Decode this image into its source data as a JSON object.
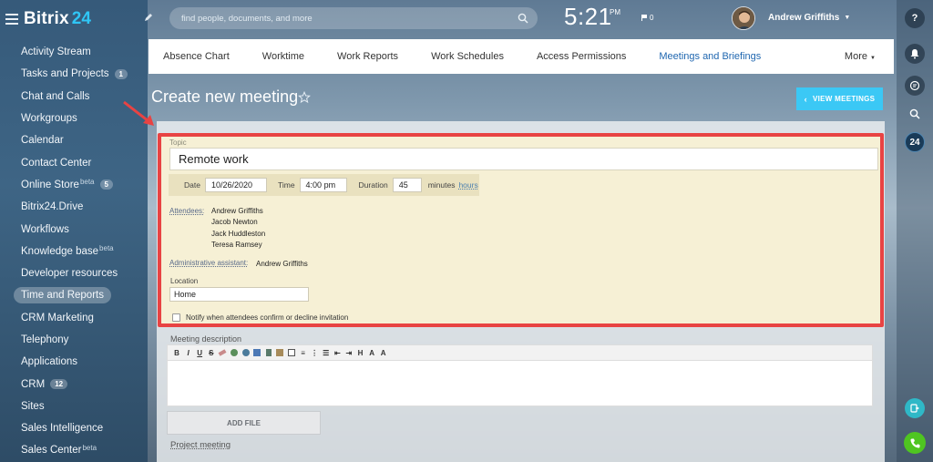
{
  "app": {
    "logo_text": "Bitrix",
    "logo_num": "24"
  },
  "sidebar": {
    "items": [
      {
        "label": "Activity Stream"
      },
      {
        "label": "Tasks and Projects",
        "count": "1"
      },
      {
        "label": "Chat and Calls"
      },
      {
        "label": "Workgroups"
      },
      {
        "label": "Calendar"
      },
      {
        "label": "Contact Center"
      },
      {
        "label": "Online Store",
        "sup": "beta",
        "count": "5"
      },
      {
        "label": "Bitrix24.Drive"
      },
      {
        "label": "Workflows"
      },
      {
        "label": "Knowledge base",
        "sup": "beta"
      },
      {
        "label": "Developer resources"
      },
      {
        "label": "Time and Reports",
        "active": true
      },
      {
        "label": "CRM Marketing"
      },
      {
        "label": "Telephony"
      },
      {
        "label": "Applications"
      },
      {
        "label": "CRM",
        "count": "12"
      },
      {
        "label": "Sites"
      },
      {
        "label": "Sales Intelligence"
      },
      {
        "label": "Sales Center",
        "sup": "beta"
      }
    ]
  },
  "header": {
    "search_placeholder": "find people, documents, and more",
    "time": "5:21",
    "ampm": "PM",
    "flag_count": "0",
    "user_name": "Andrew Griffiths"
  },
  "right_rail": {
    "counter": "24"
  },
  "tabs": [
    {
      "label": "Absence Chart"
    },
    {
      "label": "Worktime"
    },
    {
      "label": "Work Reports"
    },
    {
      "label": "Work Schedules"
    },
    {
      "label": "Access Permissions"
    },
    {
      "label": "Meetings and Briefings",
      "active": true
    }
  ],
  "tabs_more": "More",
  "page": {
    "title": "Create new meeting",
    "view_meetings_button": "VIEW MEETINGS"
  },
  "form": {
    "topic_label": "Topic",
    "topic_value": "Remote work",
    "date_label": "Date",
    "date_value": "10/26/2020",
    "time_label": "Time",
    "time_value": "4:00 pm",
    "duration_label": "Duration",
    "duration_value": "45",
    "minutes_label": "minutes",
    "hours_link": "hours",
    "attendees_label": "Attendees:",
    "attendees": [
      "Andrew Griffiths",
      "Jacob Newton",
      "Jack Huddleston",
      "Teresa Ramsey"
    ],
    "admin_label": "Administrative assistant:",
    "admin_value": "Andrew Griffiths",
    "location_label": "Location",
    "location_value": "Home",
    "notify_label": "Notify when attendees confirm or decline invitation",
    "description_label": "Meeting description",
    "add_file_button": "ADD FILE",
    "project_link": "Project meeting"
  },
  "colors": {
    "accent": "#3bc8f5",
    "highlight_border": "#e84343",
    "active_tab": "#2067b0"
  }
}
